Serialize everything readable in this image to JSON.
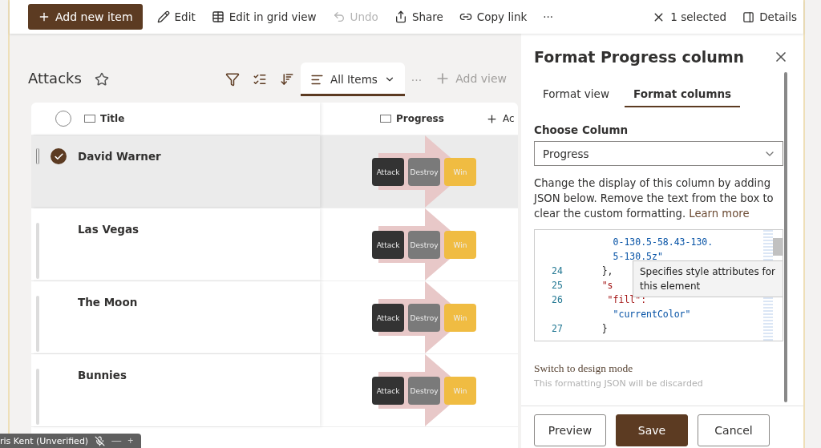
{
  "command_bar": {
    "primary": {
      "label": "Add new item"
    },
    "actions": [
      {
        "kind": "edit",
        "label": "Edit",
        "disabled": false
      },
      {
        "kind": "grid",
        "label": "Edit in grid view",
        "disabled": false
      },
      {
        "kind": "undo",
        "label": "Undo",
        "disabled": true
      },
      {
        "kind": "share",
        "label": "Share",
        "disabled": false
      },
      {
        "kind": "link",
        "label": "Copy link",
        "disabled": false
      }
    ],
    "more": "···",
    "selection": "1 selected",
    "details": "Details"
  },
  "list": {
    "title": "Attacks",
    "views": [
      {
        "label": "All Items",
        "selected": true
      }
    ],
    "more": "···",
    "add_view": "Add view"
  },
  "table": {
    "select_all": {
      "checked": false
    },
    "columns": [
      {
        "label": "Title"
      },
      {
        "label": "Progress"
      },
      {
        "label": "Ac"
      }
    ],
    "rows": [
      {
        "title": "David Warner",
        "selected": true,
        "steps": [
          {
            "label": "Attack",
            "color": "#333333"
          },
          {
            "label": "Destroy",
            "color": "#7a7a7a"
          },
          {
            "label": "Win",
            "color": "#f0bc42"
          }
        ]
      },
      {
        "title": "Las Vegas",
        "selected": false,
        "steps": [
          {
            "label": "Attack",
            "color": "#333333"
          },
          {
            "label": "Destroy",
            "color": "#7a7a7a"
          },
          {
            "label": "Win",
            "color": "#f0bc42"
          }
        ]
      },
      {
        "title": "The Moon",
        "selected": false,
        "steps": [
          {
            "label": "Attack",
            "color": "#333333"
          },
          {
            "label": "Destroy",
            "color": "#7a7a7a"
          },
          {
            "label": "Win",
            "color": "#f0bc42"
          }
        ]
      },
      {
        "title": "Bunnies",
        "selected": false,
        "steps": [
          {
            "label": "Attack",
            "color": "#333333"
          },
          {
            "label": "Destroy",
            "color": "#7a7a7a"
          },
          {
            "label": "Win",
            "color": "#f0bc42"
          }
        ]
      }
    ]
  },
  "panel": {
    "title": "Format Progress column",
    "tabs": [
      {
        "label": "Format view",
        "selected": false
      },
      {
        "label": "Format columns",
        "selected": true
      }
    ],
    "choose_label": "Choose Column",
    "column_value": "Progress",
    "description": "Change the display of this column by adding JSON below. Remove the text from the box to clear the custom formatting.",
    "learn_more": "Learn more",
    "code": [
      {
        "kind": "string",
        "text": "      0-130.5-58.43-130."
      },
      {
        "kind": "string",
        "text": "      5-130.5z\""
      },
      {
        "number": "24",
        "kind": "punct",
        "text": "    },"
      },
      {
        "number": "25",
        "kind": "key",
        "text": "    \"s"
      },
      {
        "number": "26",
        "kind": "key",
        "text": "     \"fill\":"
      },
      {
        "kind": "string",
        "text": "      \"currentColor\""
      },
      {
        "number": "27",
        "kind": "punct",
        "text": "    }"
      }
    ],
    "tooltip": "Specifies style attributes for this element",
    "design_mode": "Switch to design mode",
    "design_note": "This formatting JSON will be discarded",
    "buttons": [
      {
        "label": "Preview",
        "primary": false
      },
      {
        "label": "Save",
        "primary": true
      },
      {
        "label": "Cancel",
        "primary": false
      }
    ]
  },
  "call_overlay": {
    "name": "ris Kent (Unverified)",
    "minus": "—",
    "plus": "+"
  }
}
